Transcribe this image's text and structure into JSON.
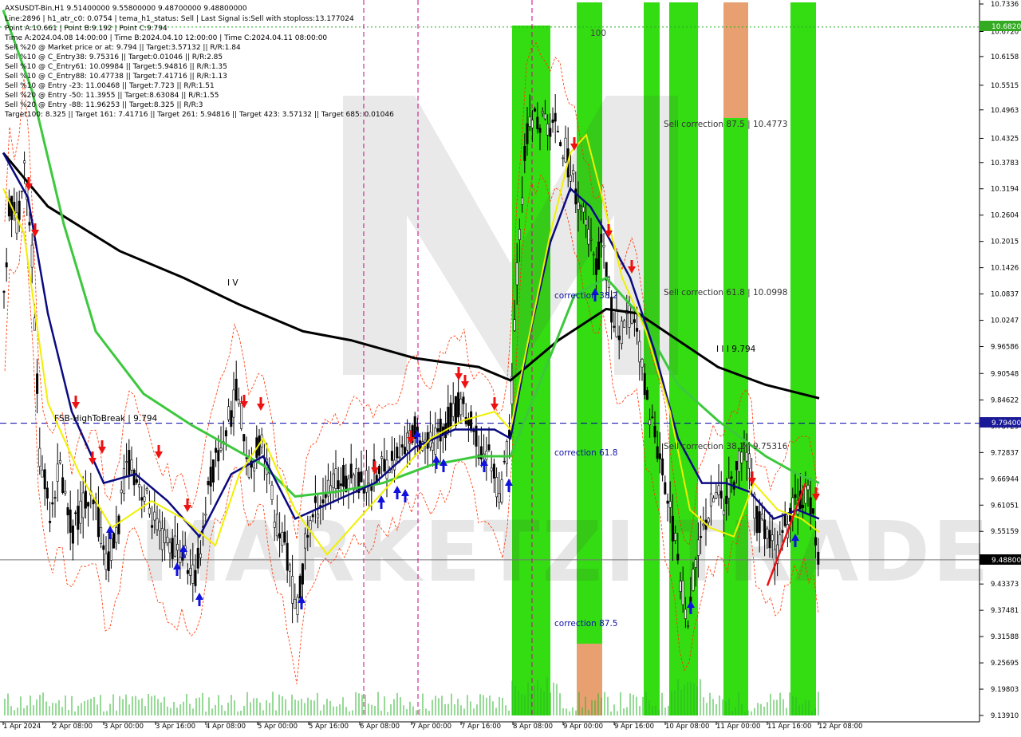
{
  "header": {
    "title": "AXSUSDT-Bin,H1  9.51400000 9.55800000 9.48700000 9.48800000",
    "lines": [
      "Line:2896  |  h1_atr_c0: 0.0754  |  tema_h1_status: Sell  |  Last Signal is:Sell with stoploss:13.177024",
      "Point A:10.661  |  Point B:9.192  |  Point C:9.794",
      "Time A:2024.04.08 14:00:00  |  Time B:2024.04.10 12:00:00  |  Time C:2024.04.11 08:00:00",
      "Sell %20 @ Market price or at: 9.794  ||  Target:3.57132  ||  R/R:1.84",
      "Sell %10 @ C_Entry38: 9.75316  ||  Target:0.01046  ||  R/R:2.85",
      "Sell %10 @ C_Entry61: 10.09984  ||  Target:5.94816  ||  R/R:1.35",
      "Sell %10 @ C_Entry88: 10.47738  ||  Target:7.41716  ||  R/R:1.13",
      "Sell %10 @ Entry -23: 11.00468  ||  Target:7.723  ||  R/R:1.51",
      "Sell %20 @ Entry -50: 11.3955  ||  Target:8.63084  ||  R/R:1.55",
      "Sell %20 @ Entry -88: 11.96253  ||  Target:8.325  ||  R/R:3",
      "Target100: 8.325  ||  Target 161: 7.41716  ||  Target 261: 5.94816  ||  Target 423: 3.57132  ||  Target 685: 0.01046"
    ]
  },
  "annotations": {
    "wave_iv": "I V",
    "wave_iii": "I I I 9.794",
    "label_100": "100",
    "fsb": "FSB-HighToBreak | 9.794",
    "correction_382": "correction 38.2",
    "correction_618": "correction 61.8",
    "correction_875": "correction 87.5",
    "sell_corr_875": "Sell correction 87.5 | 10.4773",
    "sell_corr_618": "Sell correction 61.8 | 10.0998",
    "sell_corr_382": "Sell correction 38.2 | 9.75316"
  },
  "price_tags": {
    "top": "10.6820",
    "mid": "9.79400",
    "current": "9.48800"
  },
  "watermark": "MARKETZI TRADE",
  "colors": {
    "background": "#ffffff",
    "green_zone": "#33dd11",
    "orange_zone": "#e8a070",
    "ema_black": "#000000",
    "ma_green": "#3cc83c",
    "ma_navy": "#0a0a80",
    "ma_yellow": "#f0f000",
    "envelope": "#ff3300",
    "blue_dashed": "#0000aa",
    "magenta": "#cc0088",
    "sell_arrow": "#ee1111",
    "buy_arrow": "#1111dd"
  },
  "chart_data": {
    "type": "candlestick",
    "symbol": "AXSUSDT",
    "timeframe": "H1",
    "ylim": [
      9.1391,
      10.7336
    ],
    "y_ticks": [
      "10.7336",
      "10.6720",
      "10.6158",
      "10.5515",
      "10.4963",
      "10.4325",
      "10.3783",
      "10.3194",
      "10.2604",
      "10.2015",
      "10.1426",
      "10.0837",
      "10.0247",
      "9.96586",
      "9.90548",
      "9.84622",
      "9.78729",
      "9.72837",
      "9.66944",
      "9.61051",
      "9.55159",
      "9.49266",
      "9.43373",
      "9.37481",
      "9.31588",
      "9.25695",
      "9.19803",
      "9.13910"
    ],
    "x_labels": [
      "1 Apr 2024",
      "2 Apr 08:00",
      "3 Apr 00:00",
      "3 Apr 16:00",
      "4 Apr 08:00",
      "5 Apr 00:00",
      "5 Apr 16:00",
      "6 Apr 08:00",
      "7 Apr 00:00",
      "7 Apr 16:00",
      "8 Apr 08:00",
      "9 Apr 00:00",
      "9 Apr 16:00",
      "10 Apr 08:00",
      "11 Apr 00:00",
      "11 Apr 16:00",
      "12 Apr 08:00"
    ],
    "last_bar": {
      "open": 9.514,
      "high": 9.558,
      "low": 9.487,
      "close": 9.488
    },
    "levels": {
      "point_a": 10.661,
      "point_b": 9.192,
      "point_c": 9.794,
      "fsb_high_to_break": 9.794,
      "sell_corr_875": 10.4773,
      "sell_corr_618": 10.0998,
      "sell_corr_382": 9.75316
    }
  }
}
